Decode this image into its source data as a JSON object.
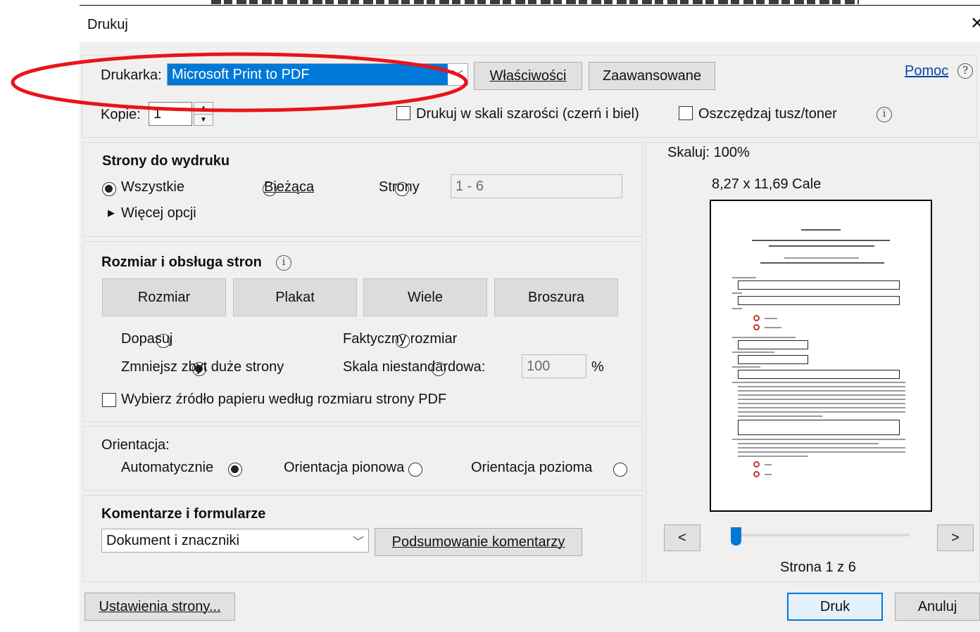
{
  "window": {
    "title": "Drukuj"
  },
  "printer": {
    "label": "Drukarka:",
    "selected": "Microsoft Print to PDF",
    "properties_button": "Właściwości",
    "advanced_button": "Zaawansowane",
    "help_link": "Pomoc"
  },
  "copies": {
    "label": "Kopie:",
    "value": "1",
    "grayscale_label": "Drukuj w skali szarości (czerń i biel)",
    "grayscale_checked": false,
    "save_ink_label": "Oszczędzaj tusz/toner",
    "save_ink_checked": false
  },
  "pages": {
    "title": "Strony do wydruku",
    "all_label": "Wszystkie",
    "current_label": "Bieżąca",
    "pages_label": "Strony",
    "range_value": "1 - 6",
    "selected": "all",
    "more_options": "Więcej opcji"
  },
  "sizing": {
    "title": "Rozmiar i obsługa stron",
    "buttons": [
      "Rozmiar",
      "Plakat",
      "Wiele",
      "Broszura"
    ],
    "fit_label": "Dopasuj",
    "actual_label": "Faktyczny rozmiar",
    "shrink_label": "Zmniejsz zbyt duże strony",
    "custom_label": "Skala niestandardowa:",
    "custom_value": "100",
    "percent": "%",
    "selected": "shrink",
    "paper_source_label": "Wybierz źródło papieru według rozmiaru strony PDF",
    "paper_source_checked": false
  },
  "orientation": {
    "title": "Orientacja:",
    "auto_label": "Automatycznie",
    "portrait_label": "Orientacja pionowa",
    "landscape_label": "Orientacja pozioma",
    "selected": "auto"
  },
  "comments": {
    "title": "Komentarze i formularze",
    "selected": "Dokument i znaczniki",
    "summary_button": "Podsumowanie komentarzy"
  },
  "preview": {
    "scale": "Skaluj: 100%",
    "dimensions": "8,27 x 11,69 Cale",
    "prev_button": "<",
    "next_button": ">",
    "page_status": "Strona 1 z 6",
    "page_current": 1,
    "page_total": 6
  },
  "footer": {
    "page_setup_button": "Ustawienia strony...",
    "print_button": "Druk",
    "cancel_button": "Anuluj"
  },
  "colors": {
    "accent": "#0078d7",
    "annotation": "#e8141a",
    "dialog_bg": "#f0f0f0"
  }
}
